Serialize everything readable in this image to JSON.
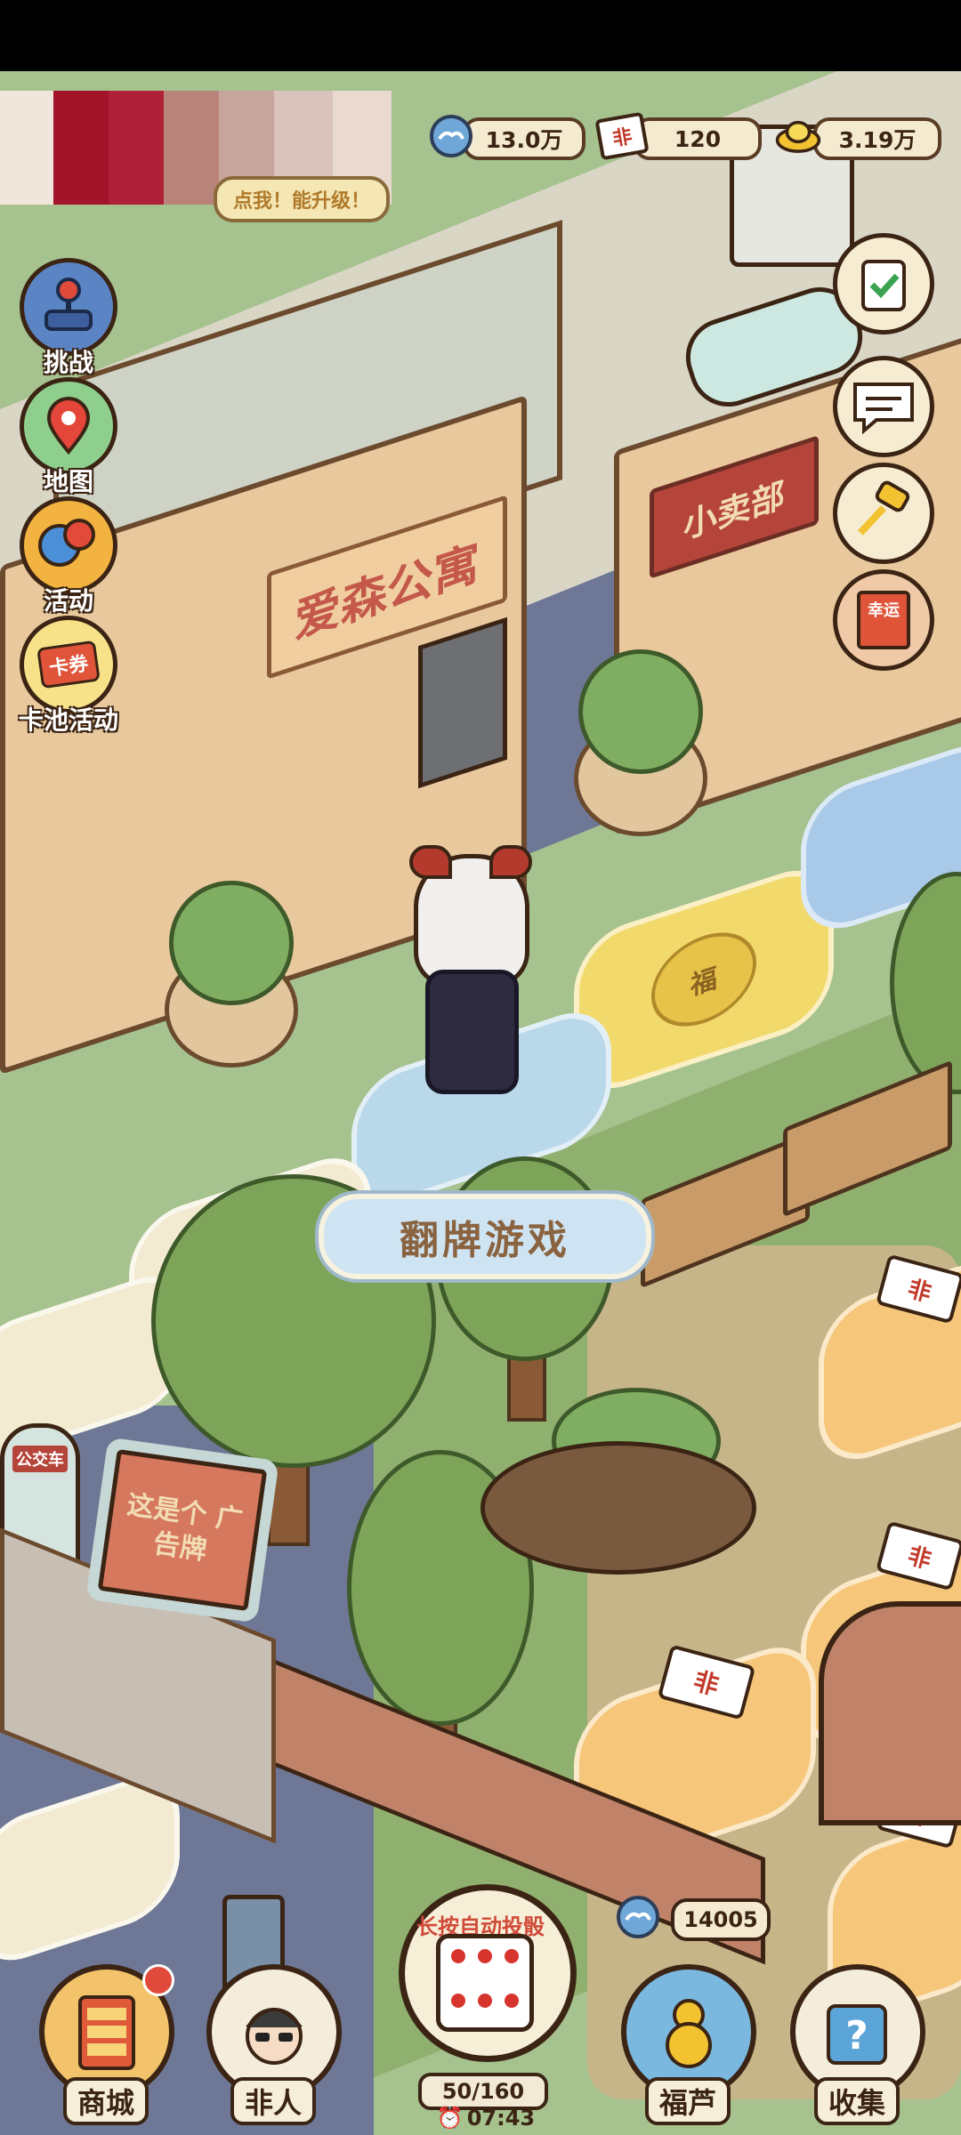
{
  "currencies": {
    "cloud": {
      "value": "13.0万",
      "icon": "cloud-coin-icon"
    },
    "ticket": {
      "value": "120",
      "icon": "fei-ticket-icon",
      "badge": "非"
    },
    "gold": {
      "value": "3.19万",
      "icon": "gold-ingot-icon"
    }
  },
  "levelup_hint": "点我！能升级！",
  "left_menu": [
    {
      "label": "挑战",
      "icon": "joystick-icon"
    },
    {
      "label": "地图",
      "icon": "map-pin-icon"
    },
    {
      "label": "活动",
      "icon": "balloons-icon"
    },
    {
      "label": "卡池活动",
      "icon": "card-ticket-icon",
      "badge": "卡券"
    }
  ],
  "right_menu": [
    {
      "name": "tasks",
      "icon": "clipboard-check-icon"
    },
    {
      "name": "chat",
      "icon": "speech-bubble-icon"
    },
    {
      "name": "auction",
      "icon": "gavel-icon"
    },
    {
      "name": "lucky",
      "icon": "lucky-cards-icon",
      "badge": "幸运"
    }
  ],
  "scene": {
    "apartment_sign": "爱森公寓",
    "shop_sign": "小卖部",
    "billboard": "这是个 广告牌",
    "bus_stop": "公交车",
    "tile_label": "翻牌游戏",
    "tile_badge": "非",
    "fu_bag": "福"
  },
  "bottom_bar": {
    "shop_label": "商城",
    "feiren_label": "非人",
    "auto_roll_hint": "长按自动投骰",
    "dice_count": "50/160",
    "timer": "07:43",
    "fulu_label": "福芦",
    "fulu_coins": "14005",
    "collect_label": "收集"
  },
  "colors": {
    "outline": "#3b2414",
    "sign_red": "#b5453a",
    "road": "#6e7896",
    "grass": "#8fb06e"
  }
}
